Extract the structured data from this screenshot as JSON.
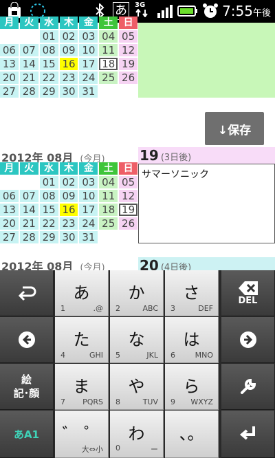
{
  "status_bar": {
    "time": "7:55",
    "time_suffix": "午後",
    "ime_indicator": "あ",
    "network": "3G",
    "icons": [
      "shopping-bag-icon",
      "sync-icon",
      "bluetooth-icon",
      "signal-icon",
      "battery-icon",
      "alarm-icon"
    ]
  },
  "calendar_top": {
    "weekday_headers": [
      "月",
      "火",
      "水",
      "木",
      "金",
      "土",
      "日"
    ],
    "rows": [
      [
        "",
        "",
        "01",
        "02",
        "03",
        "04",
        "05"
      ],
      [
        "06",
        "07",
        "08",
        "09",
        "10",
        "11",
        "12"
      ],
      [
        "13",
        "14",
        "15",
        "16",
        "17",
        "18",
        "19"
      ],
      [
        "20",
        "21",
        "22",
        "23",
        "24",
        "25",
        "26"
      ],
      [
        "27",
        "28",
        "29",
        "30",
        "31",
        "",
        ""
      ]
    ]
  },
  "save_button": {
    "label": "↓保存"
  },
  "calendar_mid": {
    "month_title": "2012年 08月",
    "month_sub": "(今月)",
    "weekday_headers": [
      "月",
      "火",
      "水",
      "木",
      "金",
      "土",
      "日"
    ],
    "rows": [
      [
        "",
        "",
        "01",
        "02",
        "03",
        "04",
        "05"
      ],
      [
        "06",
        "07",
        "08",
        "09",
        "10",
        "11",
        "12"
      ],
      [
        "13",
        "14",
        "15",
        "16",
        "17",
        "18",
        "19"
      ],
      [
        "20",
        "21",
        "22",
        "23",
        "24",
        "25",
        "26"
      ],
      [
        "27",
        "28",
        "29",
        "30",
        "31",
        "",
        ""
      ]
    ]
  },
  "day_panel": {
    "day": "19",
    "relative": "(3日後)",
    "memo": "サマーソニック"
  },
  "calendar_bottom": {
    "month_title": "2012年 08月",
    "month_sub": "(今月)",
    "day": "20",
    "relative": "(4日後)"
  },
  "keyboard": {
    "left_keys": [
      {
        "name": "undo-key",
        "label": ""
      },
      {
        "name": "left-arrow-key",
        "label": ""
      },
      {
        "name": "emoji-key",
        "label": "絵\n記･顔"
      },
      {
        "name": "mode-key",
        "label": "あA1"
      }
    ],
    "main_keys": [
      {
        "big": "あ",
        "num": "1",
        "alpha": ".@"
      },
      {
        "big": "か",
        "num": "2",
        "alpha": "ABC"
      },
      {
        "big": "さ",
        "num": "3",
        "alpha": "DEF"
      },
      {
        "big": "た",
        "num": "4",
        "alpha": "GHI"
      },
      {
        "big": "な",
        "num": "5",
        "alpha": "JKL"
      },
      {
        "big": "は",
        "num": "6",
        "alpha": "MNO"
      },
      {
        "big": "ま",
        "num": "7",
        "alpha": "PQRS"
      },
      {
        "big": "や",
        "num": "8",
        "alpha": "TUV"
      },
      {
        "big": "ら",
        "num": "9",
        "alpha": "WXYZ"
      },
      {
        "big": "゛ ゜",
        "num": "",
        "alpha": "大⇔小"
      },
      {
        "big": "わ",
        "num": "0",
        "alpha": "ー"
      },
      {
        "big": "、。",
        "num": "",
        "alpha": ""
      }
    ],
    "right_keys": [
      {
        "name": "delete-key",
        "label": "DEL"
      },
      {
        "name": "right-arrow-key",
        "label": ""
      },
      {
        "name": "settings-key",
        "label": ""
      },
      {
        "name": "enter-key",
        "label": ""
      }
    ]
  }
}
